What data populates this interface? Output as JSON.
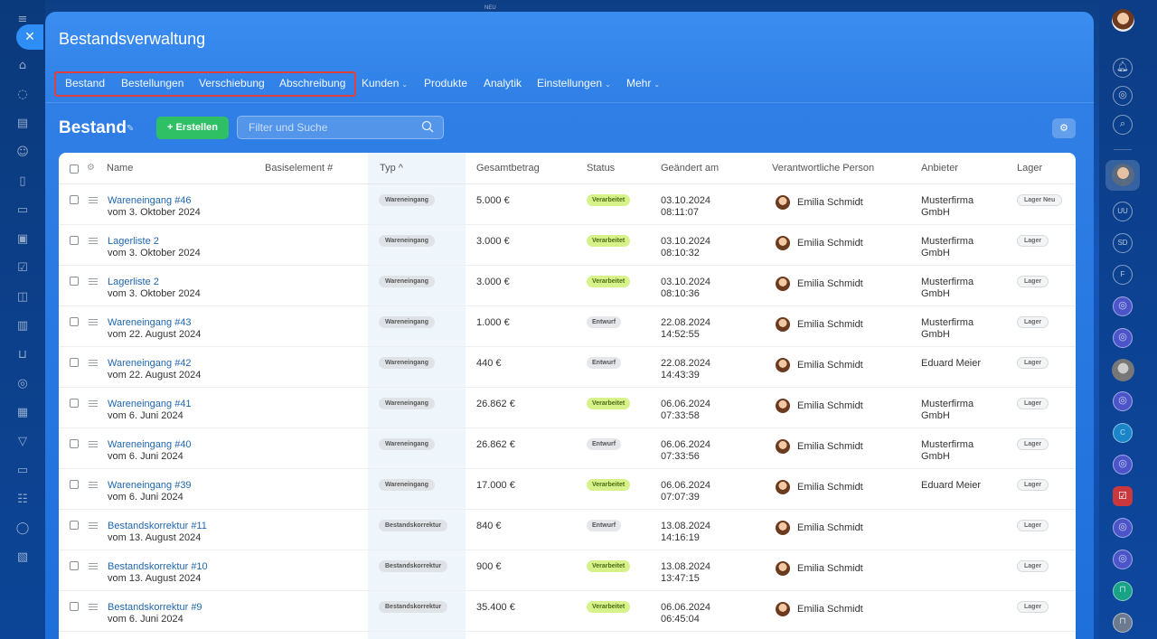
{
  "top_hint": "NEU",
  "panel": {
    "title": "Bestandsverwaltung"
  },
  "nav": {
    "items": [
      {
        "label": "Bestand"
      },
      {
        "label": "Bestellungen"
      },
      {
        "label": "Verschiebung"
      },
      {
        "label": "Abschreibung"
      },
      {
        "label": "Kunden"
      },
      {
        "label": "Produkte"
      },
      {
        "label": "Analytik"
      },
      {
        "label": "Einstellungen"
      },
      {
        "label": "Mehr"
      }
    ]
  },
  "toolbar": {
    "page_title": "Bestand",
    "create_label": "+ Erstellen",
    "search_placeholder": "Filter und Suche"
  },
  "table": {
    "headers": {
      "name": "Name",
      "base": "Basiselement #",
      "type": "Typ ^",
      "total": "Gesamtbetrag",
      "status": "Status",
      "changed": "Geändert am",
      "person": "Verantwortliche Person",
      "vendor": "Anbieter",
      "storage": "Lager"
    },
    "rows": [
      {
        "name": "Wareneingang #46",
        "date": "vom 3. Oktober 2024",
        "type": "Wareneingang",
        "total": "5.000 €",
        "status": "Verarbeitet",
        "status_kind": "ok",
        "changed_date": "03.10.2024",
        "changed_time": "08:11:07",
        "person": "Emilia Schmidt",
        "vendor_line1": "Musterfirma",
        "vendor_line2": "GmbH",
        "storage": "Lager Neu"
      },
      {
        "name": "Lagerliste 2",
        "date": "vom 3. Oktober 2024",
        "type": "Wareneingang",
        "total": "3.000 €",
        "status": "Verarbeitet",
        "status_kind": "ok",
        "changed_date": "03.10.2024",
        "changed_time": "08:10:32",
        "person": "Emilia Schmidt",
        "vendor_line1": "Musterfirma",
        "vendor_line2": "GmbH",
        "storage": "Lager"
      },
      {
        "name": "Lagerliste 2",
        "date": "vom 3. Oktober 2024",
        "type": "Wareneingang",
        "total": "3.000 €",
        "status": "Verarbeitet",
        "status_kind": "ok",
        "changed_date": "03.10.2024",
        "changed_time": "08:10:36",
        "person": "Emilia Schmidt",
        "vendor_line1": "Musterfirma",
        "vendor_line2": "GmbH",
        "storage": "Lager"
      },
      {
        "name": "Wareneingang #43",
        "date": "vom 22. August 2024",
        "type": "Wareneingang",
        "total": "1.000 €",
        "status": "Entwurf",
        "status_kind": "draft",
        "changed_date": "22.08.2024",
        "changed_time": "14:52:55",
        "person": "Emilia Schmidt",
        "vendor_line1": "Musterfirma",
        "vendor_line2": "GmbH",
        "storage": "Lager"
      },
      {
        "name": "Wareneingang #42",
        "date": "vom 22. August 2024",
        "type": "Wareneingang",
        "total": "440 €",
        "status": "Entwurf",
        "status_kind": "draft",
        "changed_date": "22.08.2024",
        "changed_time": "14:43:39",
        "person": "Emilia Schmidt",
        "vendor_line1": "Eduard Meier",
        "vendor_line2": "",
        "storage": "Lager"
      },
      {
        "name": "Wareneingang #41",
        "date": "vom 6. Juni 2024",
        "type": "Wareneingang",
        "total": "26.862 €",
        "status": "Verarbeitet",
        "status_kind": "ok",
        "changed_date": "06.06.2024",
        "changed_time": "07:33:58",
        "person": "Emilia Schmidt",
        "vendor_line1": "Musterfirma",
        "vendor_line2": "GmbH",
        "storage": "Lager"
      },
      {
        "name": "Wareneingang #40",
        "date": "vom 6. Juni 2024",
        "type": "Wareneingang",
        "total": "26.862 €",
        "status": "Entwurf",
        "status_kind": "draft",
        "changed_date": "06.06.2024",
        "changed_time": "07:33:56",
        "person": "Emilia Schmidt",
        "vendor_line1": "Musterfirma",
        "vendor_line2": "GmbH",
        "storage": "Lager"
      },
      {
        "name": "Wareneingang #39",
        "date": "vom 6. Juni 2024",
        "type": "Wareneingang",
        "total": "17.000 €",
        "status": "Verarbeitet",
        "status_kind": "ok",
        "changed_date": "06.06.2024",
        "changed_time": "07:07:39",
        "person": "Emilia Schmidt",
        "vendor_line1": "Eduard Meier",
        "vendor_line2": "",
        "storage": "Lager"
      },
      {
        "name": "Bestandskorrektur #11",
        "date": "vom 13. August 2024",
        "type": "Bestandskorrektur",
        "total": "840 €",
        "status": "Entwurf",
        "status_kind": "draft",
        "changed_date": "13.08.2024",
        "changed_time": "14:16:19",
        "person": "Emilia Schmidt",
        "vendor_line1": "",
        "vendor_line2": "",
        "storage": "Lager"
      },
      {
        "name": "Bestandskorrektur #10",
        "date": "vom 13. August 2024",
        "type": "Bestandskorrektur",
        "total": "900 €",
        "status": "Verarbeitet",
        "status_kind": "ok",
        "changed_date": "13.08.2024",
        "changed_time": "13:47:15",
        "person": "Emilia Schmidt",
        "vendor_line1": "",
        "vendor_line2": "",
        "storage": "Lager"
      },
      {
        "name": "Bestandskorrektur #9",
        "date": "vom 6. Juni 2024",
        "type": "Bestandskorrektur",
        "total": "35.400 €",
        "status": "Verarbeitet",
        "status_kind": "ok",
        "changed_date": "06.06.2024",
        "changed_time": "06:45:04",
        "person": "Emilia Schmidt",
        "vendor_line1": "",
        "vendor_line2": "",
        "storage": "Lager"
      }
    ]
  },
  "right_rail": {
    "chat_initials": [
      "UU",
      "SD",
      "F",
      "C"
    ]
  },
  "colors": {
    "accent": "#2f7fe6",
    "create_button": "#2fc065",
    "status_ok": "#d7f28b",
    "link": "#2067b0",
    "highlight_border": "#e0413d"
  }
}
